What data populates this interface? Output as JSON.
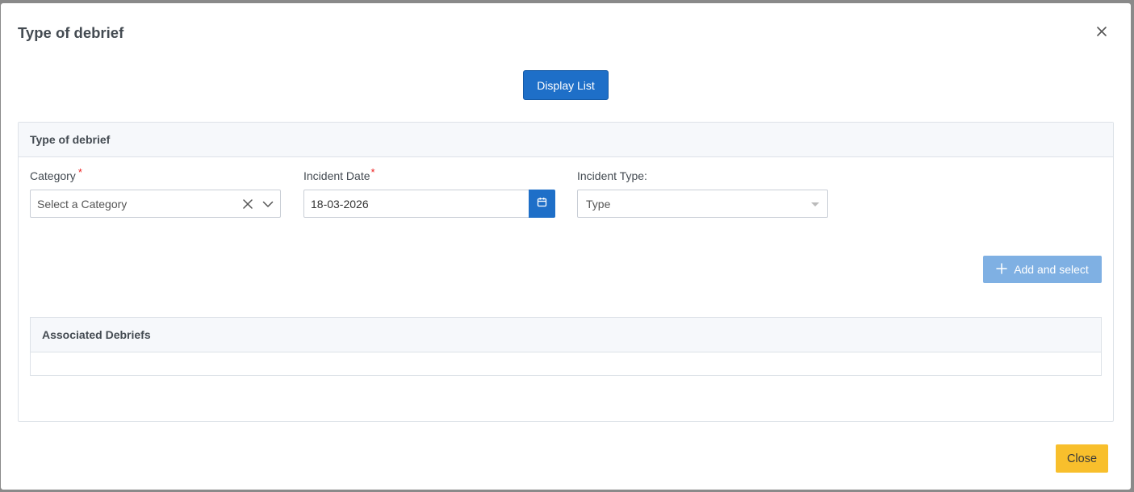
{
  "modal": {
    "title": "Type of debrief",
    "close_icon": "close-icon"
  },
  "toolbar": {
    "display_list_label": "Display List"
  },
  "panel": {
    "title": "Type of debrief",
    "category": {
      "label": "Category",
      "required_mark": "*",
      "placeholder": "Select a Category",
      "clear_icon": "clear-icon",
      "dropdown_icon": "chevron-down-icon"
    },
    "incident_date": {
      "label": "Incident Date",
      "required_mark": "*",
      "value": "18-03-2026",
      "calendar_icon": "calendar-icon"
    },
    "incident_type": {
      "label": "Incident Type:",
      "placeholder": "Type",
      "dropdown_icon": "caret-down-icon"
    },
    "add_and_select_label": "Add and select",
    "add_icon": "plus-icon",
    "associated": {
      "title": "Associated Debriefs"
    }
  },
  "footer": {
    "close_label": "Close"
  },
  "colors": {
    "primary": "#1e6fc8",
    "primary_disabled": "#7fb0e3",
    "warning": "#f8bf2c",
    "required": "#e22222"
  }
}
